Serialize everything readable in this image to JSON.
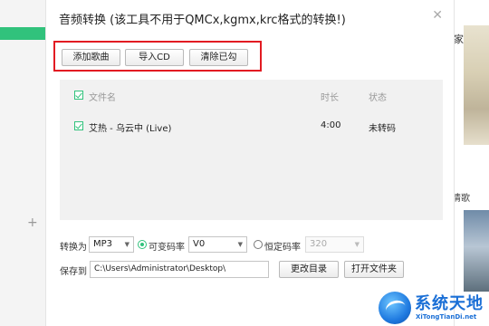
{
  "background": {
    "right_panel_text": "家",
    "recommend_text": "情歌"
  },
  "dialog": {
    "title": "音频转换 (该工具不用于QMCx,kgmx,krc格式的转换!)",
    "close_icon": "close-icon",
    "toolbar": {
      "add_song": "添加歌曲",
      "import_cd": "导入CD",
      "clear_checked": "清除已勾"
    },
    "list": {
      "columns": {
        "filename": "文件名",
        "duration": "时长",
        "status": "状态"
      },
      "rows": [
        {
          "checked": true,
          "name": "艾热 - 乌云中 (Live)",
          "duration": "4:00",
          "status": "未转码"
        }
      ]
    },
    "options": {
      "output_label": "转换为",
      "format": "MP3",
      "vbr_label": "可变码率",
      "vbr_selected": true,
      "vbr_value": "V0",
      "cbr_label": "恒定码率",
      "cbr_selected": false,
      "cbr_value": "320"
    },
    "save": {
      "label": "保存到",
      "path": "C:\\Users\\Administrator\\Desktop\\",
      "change_dir": "更改目录",
      "open_folder": "打开文件夹"
    }
  },
  "watermark": {
    "text_cn": "系统天地",
    "text_en": "XiTongTianDi.net"
  },
  "colors": {
    "accent_green": "#31c27c",
    "highlight_red": "#e21b22",
    "watermark_blue": "#1a6fd6"
  }
}
